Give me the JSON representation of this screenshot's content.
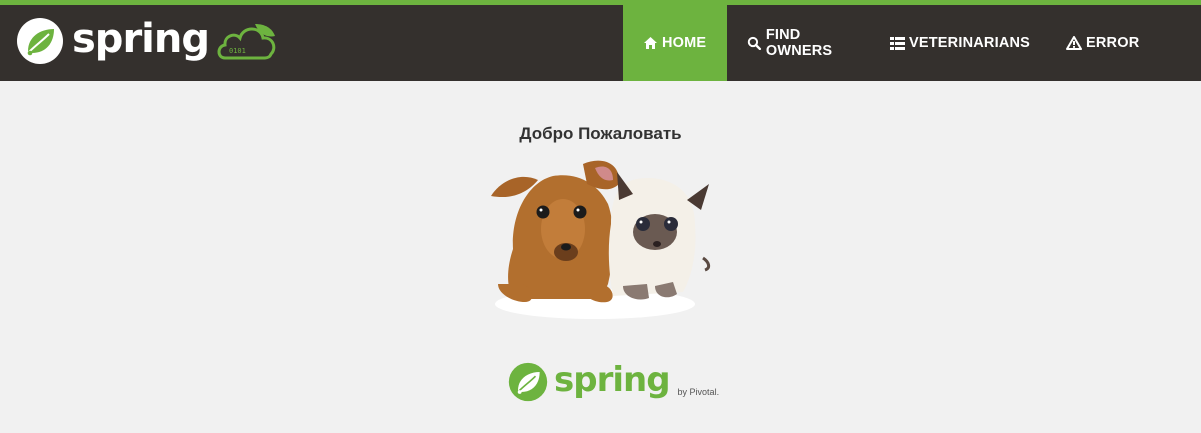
{
  "header": {
    "brand": "spring",
    "nav": [
      {
        "label": "HOME",
        "icon": "home-icon",
        "active": true
      },
      {
        "label": "FIND OWNERS",
        "icon": "search-icon",
        "active": false
      },
      {
        "label": "VETERINARIANS",
        "icon": "list-icon",
        "active": false
      },
      {
        "label": "ERROR",
        "icon": "warning-icon",
        "active": false
      }
    ]
  },
  "main": {
    "welcome": "Добро Пожаловать",
    "image": "pets-image"
  },
  "footer": {
    "brand": "spring",
    "by": "by Pivotal."
  },
  "colors": {
    "accent": "#6db33f",
    "header_bg": "#34302d",
    "page_bg": "#f1f1f1"
  }
}
